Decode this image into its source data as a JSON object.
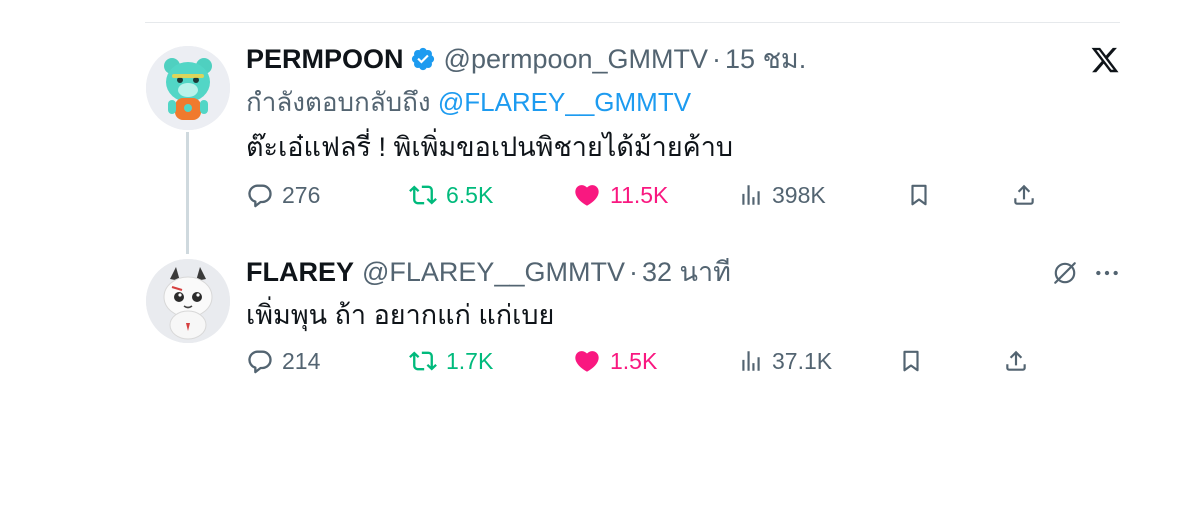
{
  "colors": {
    "text": "#0f1419",
    "secondary": "#536471",
    "link": "#1d9bf0",
    "retweet": "#00ba7c",
    "like": "#f91880"
  },
  "tweet1": {
    "display_name": "PERMPOON",
    "handle": "@permpoon_GMMTV",
    "separator": "·",
    "time": "15 ชม.",
    "reply_prefix": "กำลังตอบกลับถึง",
    "reply_handle": "@FLAREY__GMMTV",
    "text": "ต๊ะเอ๋แฟลรี่ ! พิเพิ่มขอเปนพิชายได้ม้ายค้าบ",
    "replies": "276",
    "retweets": "6.5K",
    "likes": "11.5K",
    "views": "398K"
  },
  "tweet2": {
    "display_name": "FLAREY",
    "handle": "@FLAREY__GMMTV",
    "separator": "·",
    "time": "32 นาที",
    "text": "เพิ่มพุน ถ้า อยากแก่ แก่เบย",
    "replies": "214",
    "retweets": "1.7K",
    "likes": "1.5K",
    "views": "37.1K"
  }
}
